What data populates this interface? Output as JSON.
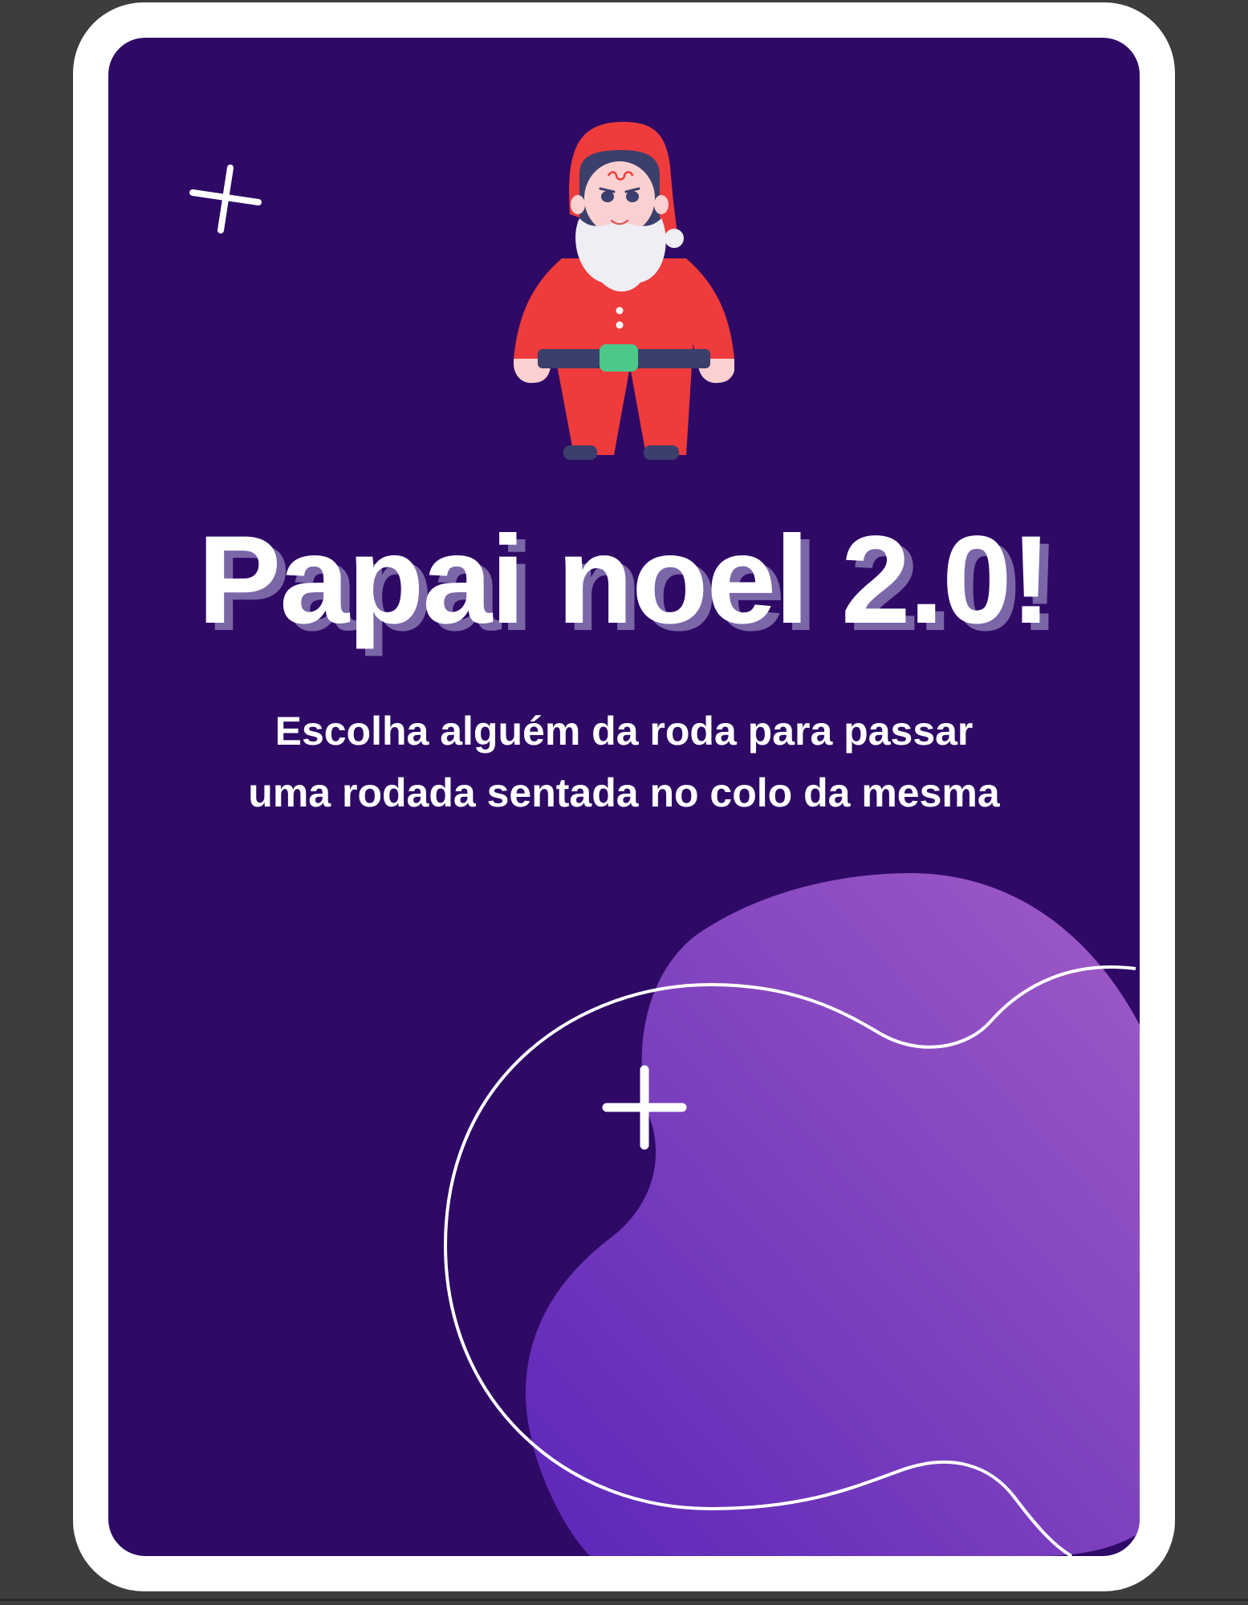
{
  "card": {
    "title": "Papai noel 2.0!",
    "description": "Escolha alguém da roda para passar uma rodada sentada no colo da mesma",
    "illustration": "santa-claus-illustration"
  },
  "colors": {
    "background": "#3d3d3d",
    "card_border": "#ffffff",
    "card_background": "#2e0a66",
    "blob_gradient_start": "#5b26b8",
    "blob_gradient_end": "#a05cc6",
    "title_shadow": "#7b66a8"
  },
  "decorations": [
    "sparkle-icon",
    "sparkle-icon",
    "purple-blob",
    "outline-blob"
  ]
}
